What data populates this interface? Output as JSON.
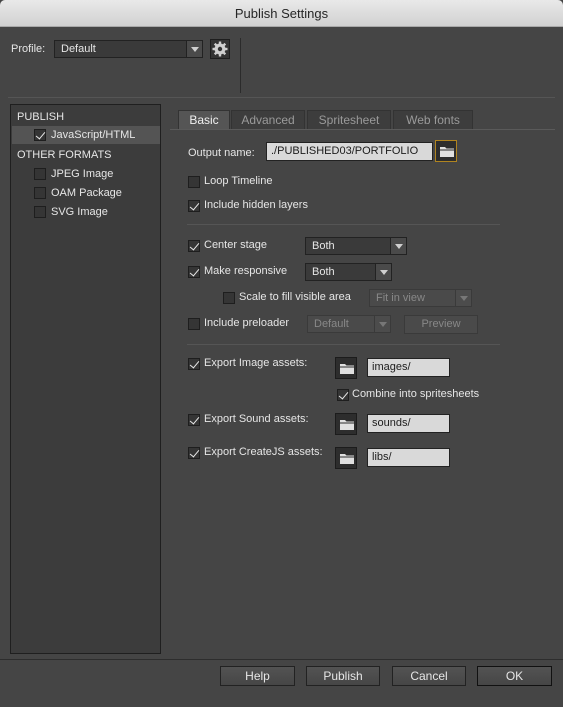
{
  "window": {
    "title": "Publish Settings"
  },
  "profile": {
    "label": "Profile:",
    "value": "Default"
  },
  "sidebar": {
    "publish_header": "PUBLISH",
    "publish_items": [
      {
        "label": "JavaScript/HTML",
        "checked": true
      }
    ],
    "other_header": "OTHER FORMATS",
    "other_items": [
      {
        "label": "JPEG Image",
        "checked": false
      },
      {
        "label": "OAM Package",
        "checked": false
      },
      {
        "label": "SVG Image",
        "checked": false
      }
    ]
  },
  "tabs": [
    {
      "label": "Basic",
      "active": true
    },
    {
      "label": "Advanced",
      "active": false
    },
    {
      "label": "Spritesheet",
      "active": false
    },
    {
      "label": "Web fonts",
      "active": false
    }
  ],
  "basic": {
    "output_name_label": "Output name:",
    "output_name_value": "./PUBLISHED03/PORTFOLIO",
    "loop_timeline": {
      "label": "Loop Timeline",
      "checked": false
    },
    "include_hidden_layers": {
      "label": "Include hidden layers",
      "checked": true
    },
    "center_stage": {
      "label": "Center stage",
      "checked": true,
      "value": "Both"
    },
    "make_responsive": {
      "label": "Make responsive",
      "checked": true,
      "value": "Both"
    },
    "scale_to_fill": {
      "label": "Scale to fill visible area",
      "checked": false,
      "value": "Fit in view"
    },
    "include_preloader": {
      "label": "Include preloader",
      "checked": false,
      "value": "Default",
      "preview_label": "Preview"
    },
    "export_image": {
      "label": "Export Image assets:",
      "checked": true,
      "path": "images/"
    },
    "combine_spritesheets": {
      "label": "Combine into spritesheets",
      "checked": true
    },
    "export_sound": {
      "label": "Export Sound assets:",
      "checked": true,
      "path": "sounds/"
    },
    "export_createjs": {
      "label": "Export CreateJS assets:",
      "checked": true,
      "path": "libs/"
    }
  },
  "footer": {
    "help": "Help",
    "publish": "Publish",
    "cancel": "Cancel",
    "ok": "OK"
  },
  "colors": {
    "background": "#454545",
    "field": "#d9d9d9",
    "titlebar": "#dcdcdc"
  },
  "icons": [
    "gear-icon",
    "folder-icon",
    "chevron-down-icon",
    "checkbox-icon"
  ]
}
